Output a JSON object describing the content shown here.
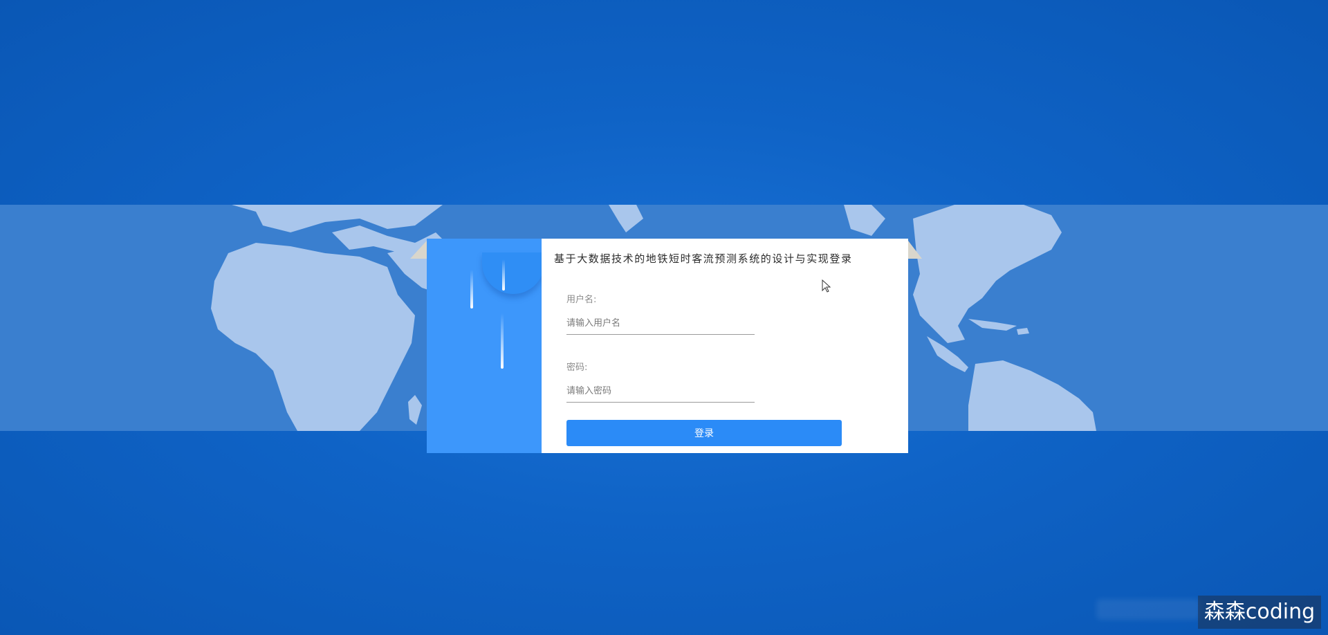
{
  "login": {
    "title": "基于大数据技术的地铁短时客流预测系统的设计与实现登录",
    "username_label": "用户名:",
    "username_placeholder": "请输入用户名",
    "password_label": "密码:",
    "password_placeholder": "请输入密码",
    "submit_label": "登录"
  },
  "watermark": {
    "text": "森森coding"
  },
  "colors": {
    "background": "#0f63c6",
    "map_band": "#3a7fcf",
    "land": "#a9c6ec",
    "panel_accent": "#3d97fb",
    "button": "#2b8bf7"
  }
}
